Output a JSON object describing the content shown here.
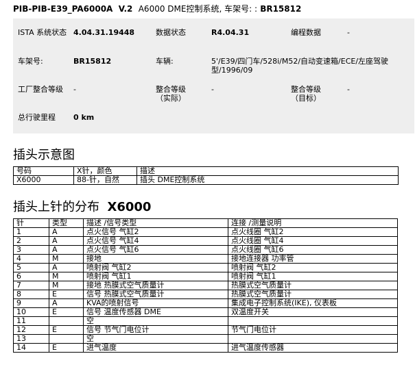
{
  "header": {
    "id": "PIB-PIB-E39_PA6000A",
    "version": "V.2",
    "desc": "A6000 DME控制系统, 车架号: :",
    "vin": "BR15812"
  },
  "info": {
    "ista_label": "ISTA 系统状态",
    "ista_value": "4.04.31.19448",
    "data_status_label": "数据状态",
    "data_status_value": "R4.04.31",
    "programming_label": "编程数据",
    "programming_value": "-",
    "vin_label": "车架号:",
    "vin_value": "BR15812",
    "vehicle_label": "车辆:",
    "vehicle_value": "5'/E39/四门车/528i/M52/自动变速箱/ECE/左座驾驶型/1996/09",
    "factory_level_label": "工厂整合等级",
    "factory_level_value": "-",
    "actual_level_label": "整合等级（实际）",
    "actual_level_value": "-",
    "target_level_label": "整合等级（目标）",
    "target_level_value": "-",
    "mileage_label": "总行驶里程",
    "mileage_value": "0 km"
  },
  "connector_section": {
    "title": "插头示意图",
    "headers": [
      "号码",
      "X针，颜色",
      "描述"
    ],
    "rows": [
      [
        "X6000",
        "88-针，自然",
        "插头 DME控制系统"
      ]
    ]
  },
  "pin_section": {
    "title": "插头上针的分布",
    "code": "X6000",
    "headers": [
      "针",
      "类型",
      "描述 /信号类型",
      "连接 /测量说明"
    ],
    "rows": [
      [
        "1",
        "A",
        "点火信号 气缸2",
        "点火线圈 气缸2"
      ],
      [
        "2",
        "A",
        "点火信号 气缸4",
        "点火线圈 气缸4"
      ],
      [
        "3",
        "A",
        "点火信号 气缸6",
        "点火线圈 气缸6"
      ],
      [
        "4",
        "M",
        "接地",
        "接地连接器 功率管"
      ],
      [
        "5",
        "A",
        "喷射阀 气缸2",
        "喷射阀 气缸2"
      ],
      [
        "6",
        "M",
        "喷射阀 气缸1",
        "喷射阀 气缸1"
      ],
      [
        "7",
        "M",
        "接地 热膜式空气质量计",
        "热膜式空气质量计"
      ],
      [
        "8",
        "E",
        "信号 热膜式空气质量计",
        "热膜式空气质量计"
      ],
      [
        "9",
        "A",
        "KVA的喷射信号",
        "集成电子控制系统(IKE), 仪表板"
      ],
      [
        "10",
        "E",
        "信号 温度传感器 DME",
        "双温度开关"
      ],
      [
        "11",
        "",
        "空",
        ""
      ],
      [
        "12",
        "E",
        "信号 节气门电位计",
        "节气门电位计"
      ],
      [
        "13",
        "",
        "空",
        ""
      ],
      [
        "14",
        "E",
        "进气温度",
        "进气温度传感器"
      ]
    ]
  }
}
